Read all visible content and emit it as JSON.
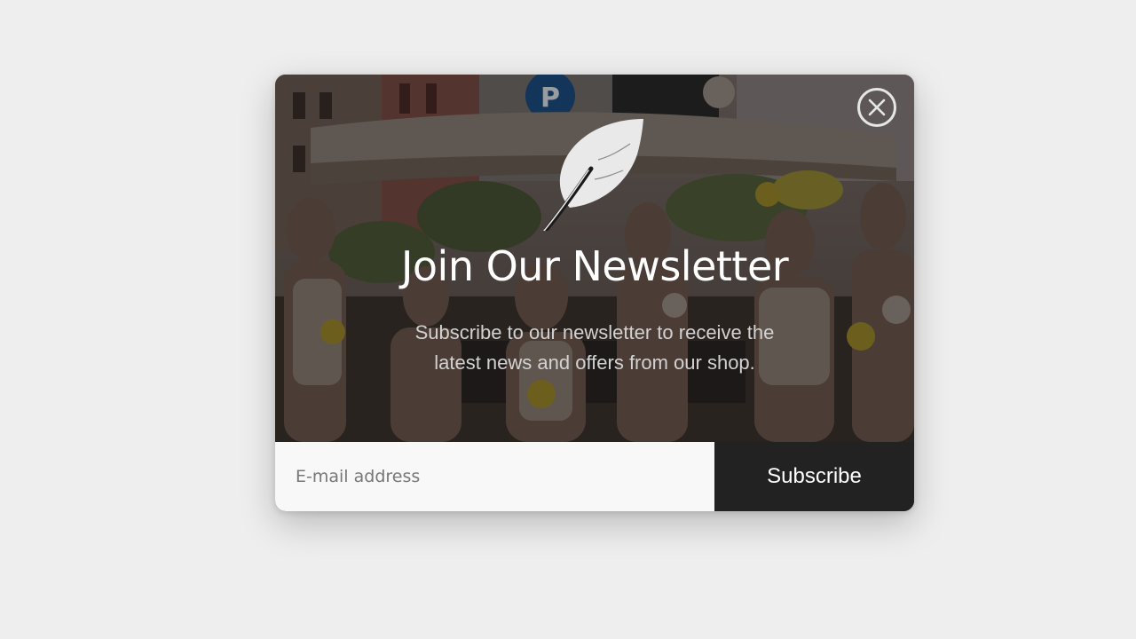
{
  "popup": {
    "title": "Join Our Newsletter",
    "subtitle": "Subscribe to our newsletter to receive the latest news and offers from our shop.",
    "email_placeholder": "E-mail address",
    "subscribe_label": "Subscribe"
  },
  "colors": {
    "page_background": "#eeeeee",
    "button_background": "#222222",
    "input_background": "#f8f8f8",
    "title_text": "#ffffff"
  },
  "icons": {
    "logo": "feather-icon",
    "close": "close-icon"
  }
}
